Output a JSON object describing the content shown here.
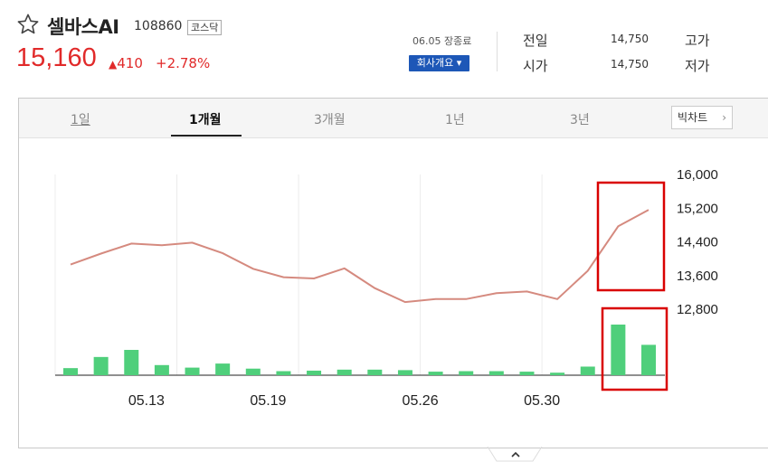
{
  "stock": {
    "name": "셀바스AI",
    "code": "108860",
    "market": "코스닥",
    "price": "15,160",
    "change": "410",
    "change_pct": "+2.78%",
    "date_status": "06.05 장종료",
    "company_button": "회사개요 ▾",
    "prev_close_label": "전일",
    "prev_close_value": "14,750",
    "open_label": "시가",
    "open_value": "14,750",
    "high_label": "고가",
    "low_label": "저가",
    "up_color": "#e12a2a"
  },
  "tabs": [
    {
      "label": "1일",
      "active": false
    },
    {
      "label": "1개월",
      "active": true
    },
    {
      "label": "3개월",
      "active": false
    },
    {
      "label": "1년",
      "active": false
    },
    {
      "label": "3년",
      "active": false
    }
  ],
  "big_chart_button": "빅차트",
  "chart_data": {
    "type": "line",
    "y_ticks": [
      "16,000",
      "15,200",
      "14,400",
      "13,600",
      "12,800"
    ],
    "ylim": [
      12800,
      16000
    ],
    "x_tick_labels": [
      "05.13",
      "05.19",
      "05.26",
      "05.30"
    ],
    "x_tick_indices": [
      3,
      7,
      12,
      16
    ],
    "series": [
      {
        "type": "line",
        "color": "#d58a7f",
        "values": [
          13860,
          14120,
          14360,
          14320,
          14380,
          14130,
          13760,
          13560,
          13530,
          13770,
          13300,
          12970,
          13040,
          13040,
          13180,
          13220,
          13040,
          13710,
          14770,
          15160
        ]
      },
      {
        "type": "bar",
        "color": "#4fcf7b",
        "values": [
          0.14,
          0.36,
          0.5,
          0.2,
          0.15,
          0.23,
          0.13,
          0.08,
          0.09,
          0.11,
          0.11,
          0.1,
          0.07,
          0.08,
          0.08,
          0.07,
          0.05,
          0.17,
          1.0,
          0.6
        ]
      }
    ],
    "highlight_color": "#d90000",
    "grid": "vertical"
  }
}
